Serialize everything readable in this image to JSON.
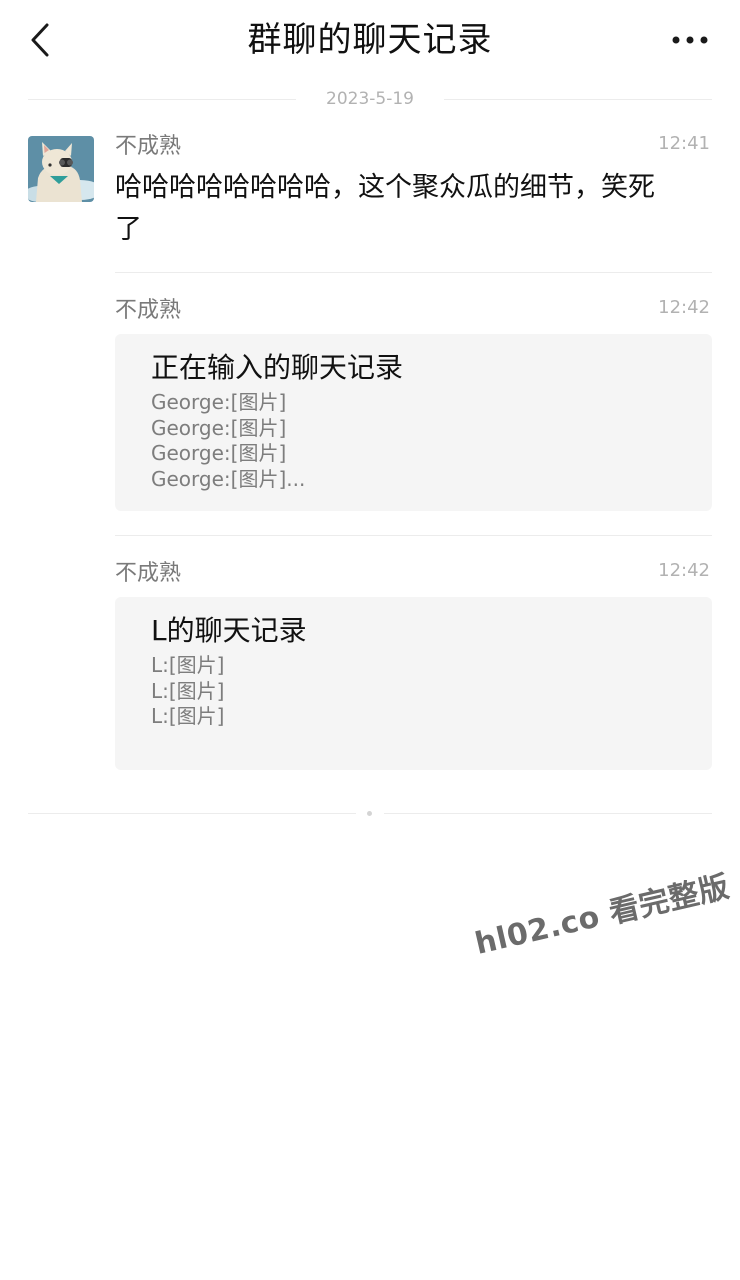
{
  "header": {
    "title": "群聊的聊天记录",
    "back_icon": "chevron-left-icon",
    "more_icon": "more-dots-icon"
  },
  "date_divider": "2023-5-19",
  "messages": [
    {
      "sender": "不成熟",
      "time": "12:41",
      "text_line1": "哈哈哈哈哈哈哈哈，这个聚众瓜的细节，笑死",
      "text_line2": "了"
    },
    {
      "sender": "不成熟",
      "time": "12:42",
      "card": {
        "title": "正在输入的聊天记录",
        "lines": [
          "George:[图片]",
          "George:[图片]",
          "George:[图片]",
          "George:[图片]..."
        ]
      }
    },
    {
      "sender": "不成熟",
      "time": "12:42",
      "card": {
        "title": "L的聊天记录",
        "lines": [
          "L:[图片]",
          "L:[图片]",
          "L:[图片]"
        ]
      }
    }
  ],
  "watermark": "hl02.co 看完整版",
  "colors": {
    "background": "#ffffff",
    "card_background": "#f5f5f5",
    "secondary_text": "#7a7a7a",
    "time_text": "#b2b2b2",
    "divider": "#ececec"
  }
}
